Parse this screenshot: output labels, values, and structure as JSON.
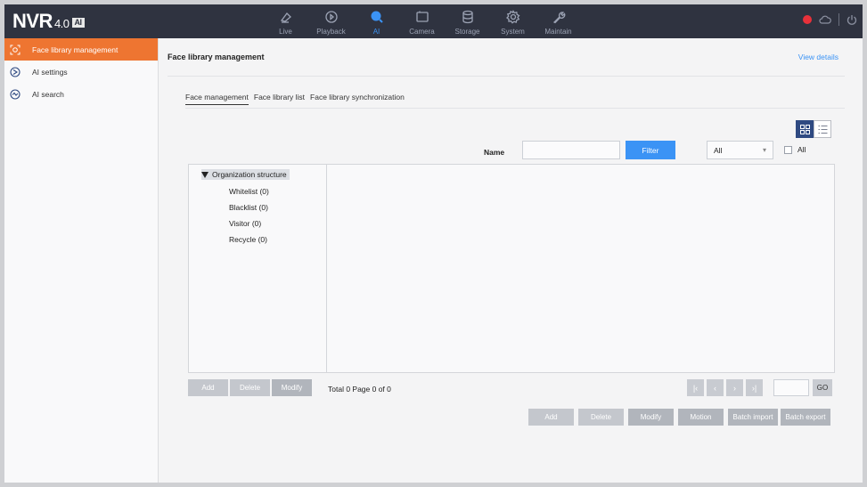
{
  "header": {
    "logo": "NVR",
    "version": "4.0",
    "badge": "AI",
    "nav": [
      {
        "label": "Live",
        "icon": "live-icon"
      },
      {
        "label": "Playback",
        "icon": "playback-icon"
      },
      {
        "label": "AI",
        "icon": "ai-icon"
      },
      {
        "label": "Camera",
        "icon": "camera-icon"
      },
      {
        "label": "Storage",
        "icon": "storage-icon"
      },
      {
        "label": "System",
        "icon": "system-gear-icon"
      },
      {
        "label": "Maintain",
        "icon": "wrench-icon"
      }
    ],
    "active_nav": "AI"
  },
  "sidebar": {
    "items": [
      {
        "label": "Face library management",
        "icon": "face-library-icon",
        "active": true
      },
      {
        "label": "AI settings",
        "icon": "ai-settings-icon",
        "active": false
      },
      {
        "label": "AI search",
        "icon": "ai-search-icon",
        "active": false
      }
    ]
  },
  "main": {
    "title": "Face library management",
    "view_details": "View details",
    "tabs": [
      {
        "label": "Face management",
        "active": true
      },
      {
        "label": "Face library list",
        "active": false
      },
      {
        "label": "Face library synchronization",
        "active": false
      }
    ],
    "filter": {
      "name_label": "Name",
      "name_value": "",
      "filter_button": "Filter",
      "select_value": "All",
      "select_arrow": "▾",
      "all_checkbox_label": "All"
    },
    "tree": {
      "root": "Organization structure",
      "children": [
        "Whitelist (0)",
        "Blacklist (0)",
        "Visitor (0)",
        "Recycle (0)"
      ]
    },
    "tree_buttons": {
      "add": "Add",
      "delete": "Delete",
      "modify": "Modify"
    },
    "pagination": {
      "total_text": "Total 0 Page 0 of 0",
      "first": "|‹",
      "prev": "‹",
      "next": "›",
      "last": "›|",
      "go": "GO"
    },
    "actions": {
      "add": "Add",
      "delete": "Delete",
      "modify": "Modify",
      "motion": "Motion",
      "batch_import": "Batch import",
      "batch_export": "Batch export"
    }
  }
}
